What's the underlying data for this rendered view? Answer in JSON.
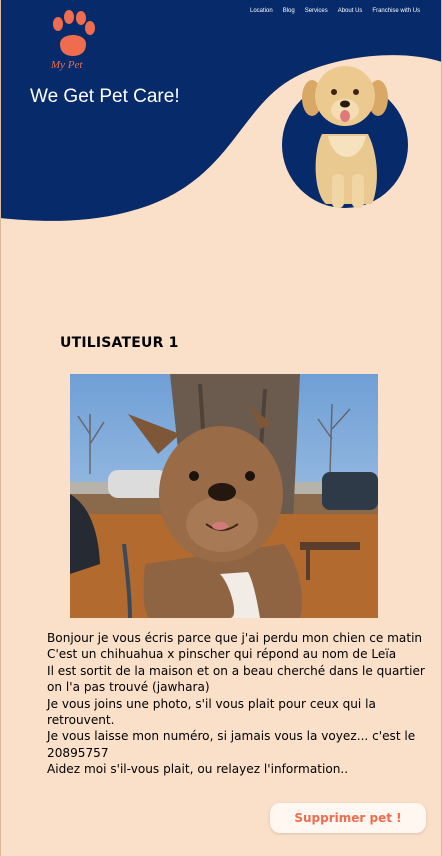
{
  "colors": {
    "navy": "#062a6a",
    "peach": "#fbe0c9",
    "accent": "#ef6d4e"
  },
  "brand": {
    "logo_text": "My Pet"
  },
  "nav": {
    "items": [
      {
        "label": "Location"
      },
      {
        "label": "Blog"
      },
      {
        "label": "Services"
      },
      {
        "label": "About Us"
      },
      {
        "label": "Franchise with Us"
      }
    ]
  },
  "hero": {
    "title": "We Get Pet Care!"
  },
  "post": {
    "title": "UTILISATEUR 1",
    "lines": [
      "Bonjour je vous écris parce que j'ai perdu mon chien ce matin",
      "C'est un chihuahua x pinscher qui répond au nom de Leïa",
      "Il est sortit de la maison et on a beau cherché dans le quartier on l'a pas trouvé (jawhara)",
      "Je vous joins une photo, s'il vous plait pour ceux qui la retrouvent.",
      "Je vous laisse mon numéro, si jamais vous la voyez... c'est le 20895757",
      "Aidez moi s'il-vous plait, ou relayez l'information.."
    ]
  },
  "actions": {
    "delete_label": "Supprimer pet !"
  }
}
